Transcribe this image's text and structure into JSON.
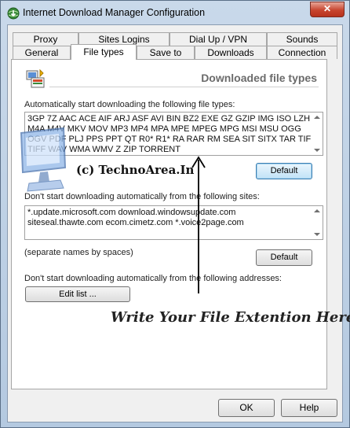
{
  "window": {
    "title": "Internet Download Manager Configuration",
    "close_glyph": "✕",
    "app_icon": "globe-download-icon"
  },
  "tabs": {
    "row1": [
      "Proxy",
      "Sites Logins",
      "Dial Up / VPN",
      "Sounds"
    ],
    "row2": [
      "General",
      "File types",
      "Save to",
      "Downloads",
      "Connection"
    ],
    "active": "File types"
  },
  "panel": {
    "icon": "file-types-icon",
    "title": "Downloaded file types",
    "filetypes_label": "Automatically start downloading the following file types:",
    "filetypes_value": "3GP 7Z AAC ACE AIF ARJ ASF AVI BIN BZ2 EXE GZ GZIP IMG ISO LZH M4A M4V MKV MOV MP3 MP4 MPA MPE MPEG MPG MSI MSU OGG OGV PDF PLJ PPS PPT QT R0* R1* RA RAR RM SEA SIT SITX TAR TIF TIFF WAV WMA WMV Z ZIP TORRENT",
    "filetypes_default_label": "Default",
    "sites_label": "Don't start downloading automatically from the following sites:",
    "sites_value": "*.update.microsoft.com download.windowsupdate.com siteseal.thawte.com ecom.cimetz.com *.voice2page.com",
    "sites_hint": "(separate names by spaces)",
    "sites_default_label": "Default",
    "addresses_label": "Don't start downloading automatically from the following addresses:",
    "edit_list_label": "Edit list ..."
  },
  "overlay": {
    "watermark": "(c) TechnoArea.In",
    "annotation": "Write Your File Extention Here"
  },
  "footer": {
    "ok_label": "OK",
    "help_label": "Help"
  },
  "colors": {
    "title_bar": "#b9cde3",
    "close_button": "#c7452f",
    "focus_button": "#3c7fb1"
  }
}
